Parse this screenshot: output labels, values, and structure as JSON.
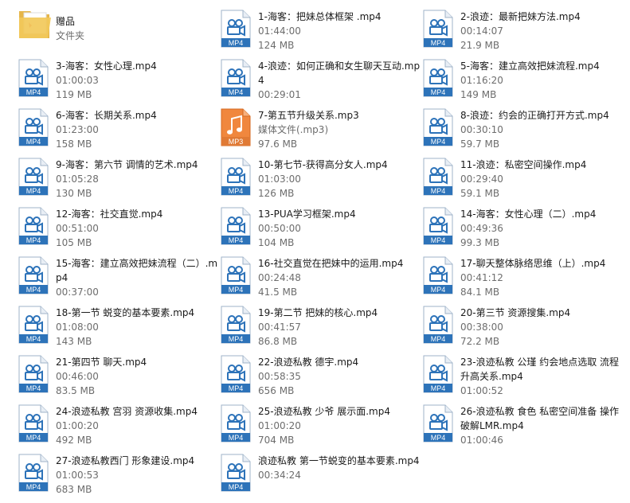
{
  "colors": {
    "mp4_band": "#2d73b9",
    "mp3_band": "#e07a35",
    "folder": "#f2c95a",
    "text_primary": "#1a1a1a",
    "text_secondary": "#6d6d6d"
  },
  "items": [
    {
      "kind": "folder",
      "name": "赠品",
      "meta": "文件夹",
      "size": ""
    },
    {
      "kind": "mp4",
      "name": "1-海客：把妹总体框架 .mp4",
      "meta": "01:44:00",
      "size": "124 MB"
    },
    {
      "kind": "mp4",
      "name": "2-浪迹：最新把妹方法.mp4",
      "meta": "00:14:07",
      "size": "21.9 MB"
    },
    {
      "kind": "mp4",
      "name": "3-海客：女性心理.mp4",
      "meta": "01:00:03",
      "size": "119 MB"
    },
    {
      "kind": "mp4",
      "name": "4-浪迹：如何正确和女生聊天互动.mp4",
      "meta": "00:29:01",
      "size": ""
    },
    {
      "kind": "mp4",
      "name": "5-海客：建立高效把妹流程.mp4",
      "meta": "01:16:20",
      "size": "149 MB"
    },
    {
      "kind": "mp4",
      "name": "6-海客：长期关系.mp4",
      "meta": "01:23:00",
      "size": "158 MB"
    },
    {
      "kind": "mp3",
      "name": "7-第五节升级关系.mp3",
      "meta": "媒体文件(.mp3)",
      "size": "97.6 MB"
    },
    {
      "kind": "mp4",
      "name": "8-浪迹：约会的正确打开方式.mp4",
      "meta": "00:30:10",
      "size": "59.7 MB"
    },
    {
      "kind": "mp4",
      "name": "9-海客：第六节 调情的艺术.mp4",
      "meta": "01:05:28",
      "size": "130 MB"
    },
    {
      "kind": "mp4",
      "name": "10-第七节-获得高分女人.mp4",
      "meta": "01:03:00",
      "size": "126 MB"
    },
    {
      "kind": "mp4",
      "name": "11-浪迹：私密空间操作.mp4",
      "meta": "00:29:40",
      "size": "59.1 MB"
    },
    {
      "kind": "mp4",
      "name": "12-海客：社交直觉.mp4",
      "meta": "00:51:00",
      "size": "105 MB"
    },
    {
      "kind": "mp4",
      "name": "13-PUA学习框架.mp4",
      "meta": "00:50:00",
      "size": "104 MB"
    },
    {
      "kind": "mp4",
      "name": "14-海客：女性心理（二）.mp4",
      "meta": "00:49:36",
      "size": "99.3 MB"
    },
    {
      "kind": "mp4",
      "name": "15-海客：建立高效把妹流程（二）.mp4",
      "meta": "00:37:00",
      "size": ""
    },
    {
      "kind": "mp4",
      "name": "16-社交直觉在把妹中的运用.mp4",
      "meta": "00:24:48",
      "size": "41.5 MB"
    },
    {
      "kind": "mp4",
      "name": "17-聊天整体脉络思维（上）.mp4",
      "meta": "00:41:12",
      "size": "84.1 MB"
    },
    {
      "kind": "mp4",
      "name": "18-第一节 蜕变的基本要素.mp4",
      "meta": "01:08:00",
      "size": "143 MB"
    },
    {
      "kind": "mp4",
      "name": "19-第二节 把妹的核心.mp4",
      "meta": "00:41:57",
      "size": "86.8 MB"
    },
    {
      "kind": "mp4",
      "name": "20-第三节 资源搜集.mp4",
      "meta": "00:38:00",
      "size": "72.2 MB"
    },
    {
      "kind": "mp4",
      "name": "21-第四节 聊天.mp4",
      "meta": "00:46:00",
      "size": "83.5 MB"
    },
    {
      "kind": "mp4",
      "name": "22-浪迹私教 德宇.mp4",
      "meta": "00:58:35",
      "size": "656 MB"
    },
    {
      "kind": "mp4",
      "name": "23-浪迹私教 公瑾 约会地点选取 流程 升高关系.mp4",
      "meta": "01:00:52",
      "size": ""
    },
    {
      "kind": "mp4",
      "name": "24-浪迹私教 宫羽 资源收集.mp4",
      "meta": "01:00:20",
      "size": "492 MB"
    },
    {
      "kind": "mp4",
      "name": "25-浪迹私教 少爷 展示面.mp4",
      "meta": "01:00:20",
      "size": "704 MB"
    },
    {
      "kind": "mp4",
      "name": "26-浪迹私教 食色 私密空间准备 操作破解LMR.mp4",
      "meta": "01:00:46",
      "size": ""
    },
    {
      "kind": "mp4",
      "name": "27-浪迹私教西门 形象建设.mp4",
      "meta": "01:00:53",
      "size": "683 MB"
    },
    {
      "kind": "mp4",
      "name": "浪迹私教 第一节蜕变的基本要素.mp4",
      "meta": "00:34:24",
      "size": ""
    }
  ],
  "labels": {
    "mp4": "MP4",
    "mp3": "MP3"
  }
}
